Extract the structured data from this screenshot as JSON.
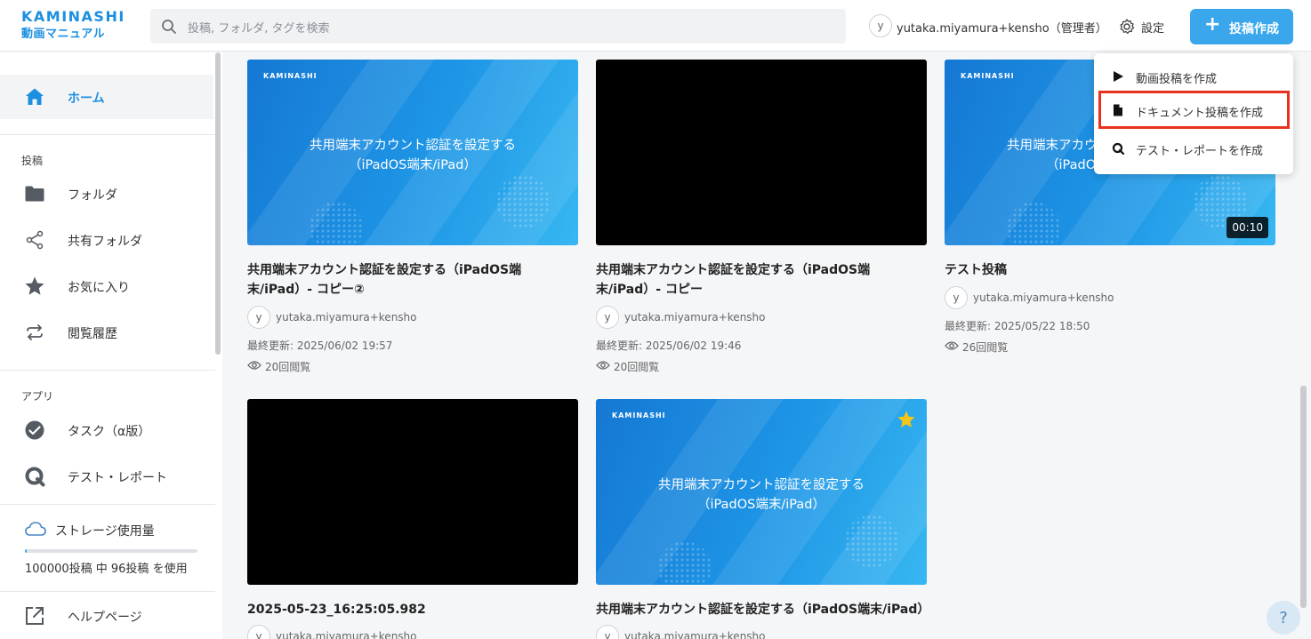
{
  "header": {
    "logo_line1": "KAMINASHI",
    "logo_line2": "動画マニュアル",
    "search_placeholder": "投稿, フォルダ, タグを検索",
    "user_initial": "y",
    "user_name": "yutaka.miyamura+kensho（管理者）",
    "settings_label": "設定",
    "create_label": "投稿作成"
  },
  "sidebar": {
    "home": "ホーム",
    "section_posts": "投稿",
    "folder": "フォルダ",
    "shared_folder": "共有フォルダ",
    "favorites": "お気に入り",
    "history": "閲覧履歴",
    "section_apps": "アプリ",
    "tasks": "タスク（α版）",
    "tests": "テスト・レポート",
    "storage_title": "ストレージ使用量",
    "storage_usage": "100000投稿 中 96投稿 を使用",
    "storage_fraction": 0.001,
    "help": "ヘルプページ"
  },
  "dropdown": {
    "video": "動画投稿を作成",
    "document": "ドキュメント投稿を作成",
    "test": "テスト・レポートを作成"
  },
  "cards": [
    {
      "thumb_brand": "KAMINASHI",
      "thumb_title_1": "共用端末アカウント認証を設定する",
      "thumb_title_2": "（iPadOS端末/iPad）",
      "title": "共用端末アカウント認証を設定する（iPadOS端末/iPad）- コピー②",
      "user_initial": "y",
      "user": "yutaka.miyamura+kensho",
      "updated": "最終更新: 2025/06/02 19:57",
      "views": "20回閲覧"
    },
    {
      "title": "共用端末アカウント認証を設定する（iPadOS端末/iPad）- コピー",
      "user_initial": "y",
      "user": "yutaka.miyamura+kensho",
      "updated": "最終更新: 2025/06/02 19:46",
      "views": "20回閲覧"
    },
    {
      "thumb_brand": "KAMINASHI",
      "thumb_title_1": "共用端末アカウント認証を設定する",
      "thumb_title_2": "（iPadOS端末/iPad）",
      "duration": "00:10",
      "title": "テスト投稿",
      "user_initial": "y",
      "user": "yutaka.miyamura+kensho",
      "updated": "最終更新: 2025/05/22 18:50",
      "views": "26回閲覧"
    },
    {
      "title": "2025-05-23_16:25:05.982",
      "user_initial": "y",
      "user": "yutaka.miyamura+kensho"
    },
    {
      "thumb_brand": "KAMINASHI",
      "thumb_title_1": "共用端末アカウント認証を設定する",
      "thumb_title_2": "（iPadOS端末/iPad）",
      "title": "共用端末アカウント認証を設定する（iPadOS端末/iPad）",
      "user_initial": "y",
      "user": "yutaka.miyamura+kensho"
    }
  ],
  "help_fab": "?",
  "colors": {
    "brand": "#1c8fe0",
    "button": "#3aa7ec",
    "highlight": "#e8321f",
    "star": "#f5c518"
  }
}
